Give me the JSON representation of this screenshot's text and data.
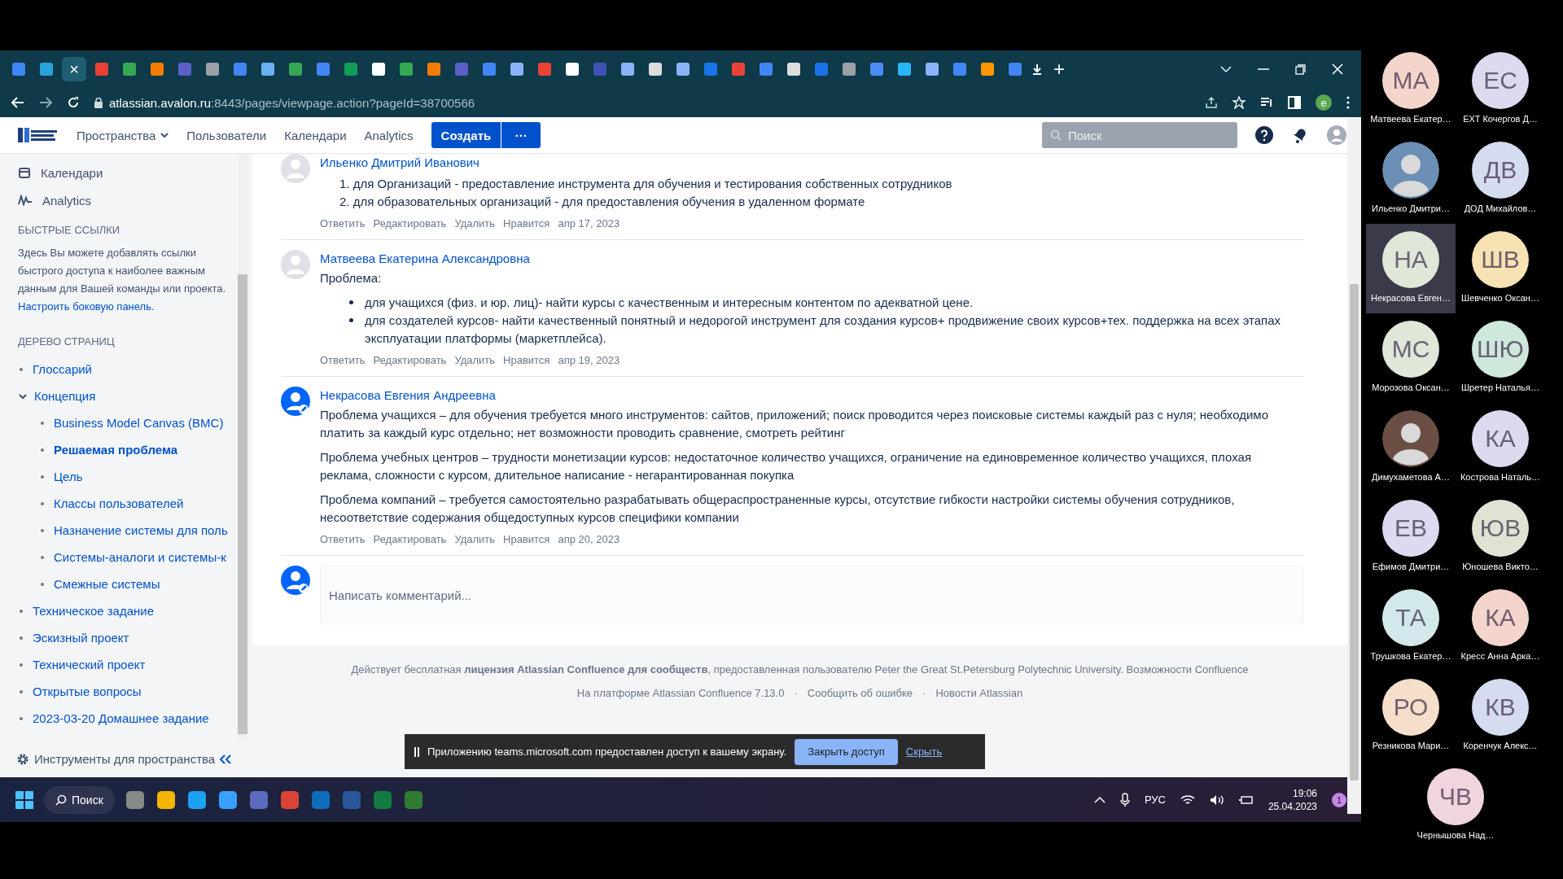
{
  "browser": {
    "tabs": [
      {
        "selected": false
      },
      {
        "selected": false
      },
      {
        "selected": true
      },
      {
        "selected": false
      },
      {
        "selected": false
      },
      {
        "selected": false
      },
      {
        "selected": false
      },
      {
        "selected": false
      },
      {
        "selected": false
      },
      {
        "selected": false
      },
      {
        "selected": false
      },
      {
        "selected": false
      },
      {
        "selected": false
      },
      {
        "selected": false
      },
      {
        "selected": false
      },
      {
        "selected": false
      },
      {
        "selected": false
      },
      {
        "selected": false
      },
      {
        "selected": false
      },
      {
        "selected": false
      },
      {
        "selected": false
      },
      {
        "selected": false
      },
      {
        "selected": false
      },
      {
        "selected": false
      },
      {
        "selected": false
      },
      {
        "selected": false
      },
      {
        "selected": false
      },
      {
        "selected": false
      },
      {
        "selected": false
      },
      {
        "selected": false
      },
      {
        "selected": false
      },
      {
        "selected": false
      },
      {
        "selected": false
      },
      {
        "selected": false
      },
      {
        "selected": false
      },
      {
        "selected": false
      },
      {
        "selected": false
      }
    ],
    "tab_close": "×",
    "new_tab": "+",
    "profile_letter": "e",
    "url_host": "atlassian.avalon.ru",
    "url_rest": ":8443/pages/viewpage.action?pageId=38700566"
  },
  "header": {
    "nav": [
      {
        "label": "Пространства",
        "kind": "menu"
      },
      {
        "label": "Пользователи",
        "kind": "link"
      },
      {
        "label": "Календари",
        "kind": "link"
      },
      {
        "label": "Analytics",
        "kind": "link"
      }
    ],
    "create": "Создать",
    "more": "···",
    "search": {
      "placeholder": "Поиск"
    }
  },
  "sidebar": {
    "links": [
      {
        "label": "Календари",
        "kind": "calendar"
      },
      {
        "label": "Analytics",
        "kind": "analytics"
      }
    ],
    "quick_links_title": "БЫСТРЫЕ ССЫЛКИ",
    "quick_links_text": "Здесь Вы можете добавлять ссылки быстрого доступа к наиболее важным данным для Вашей команды или проекта.",
    "quick_links_link": "Настроить боковую панель.",
    "tree_title": "ДЕРЕВО СТРАНИЦ",
    "tree": [
      {
        "label": "Глоссарий",
        "selected": false
      },
      {
        "label": "Концепция",
        "selected": false,
        "expanded": true,
        "children": [
          {
            "label": "Business Model Canvas (BMC)",
            "selected": false
          },
          {
            "label": "Решаемая проблема",
            "selected": true
          },
          {
            "label": "Цель",
            "selected": false
          },
          {
            "label": "Классы пользователей",
            "selected": false
          },
          {
            "label": "Назначение системы для поль",
            "selected": false
          },
          {
            "label": "Системы-аналоги и системы-к",
            "selected": false
          },
          {
            "label": "Смежные системы",
            "selected": false
          }
        ]
      },
      {
        "label": "Техническое задание",
        "selected": false
      },
      {
        "label": "Эскизный проект",
        "selected": false
      },
      {
        "label": "Технический проект",
        "selected": false
      },
      {
        "label": "Открытые вопросы",
        "selected": false
      },
      {
        "label": "2023-03-20 Домашнее задание",
        "selected": false
      }
    ],
    "tools": "Инструменты для пространства"
  },
  "comments": [
    {
      "author": "Ильенко Дмитрий Иванович",
      "custom_avatar": false,
      "blocks": [
        {
          "kind": "ordered_list",
          "items": [
            {
              "number": "1.",
              "text": "для Организаций - предоставление инструмента для обучения и тестирования собственных сотрудников"
            },
            {
              "number": "2.",
              "text": "для образовательных организаций - для предоставления обучения в удаленном формате"
            }
          ]
        }
      ],
      "actions": [
        "Ответить",
        "Редактировать",
        "Удалить",
        "Нравится"
      ],
      "date": "апр 17, 2023"
    },
    {
      "author": "Матвеева Екатерина Александровна",
      "custom_avatar": false,
      "blocks": [
        {
          "kind": "paragraph",
          "text": "Проблема:"
        },
        {
          "kind": "bullet_list",
          "items": [
            "для учащихся (физ. и юр. лиц)- найти курсы с качественным и интересным контентом по адекватной цене.",
            "для создателей курсов- найти качественный понятный и недорогой инструмент для создания курсов+ продвижение своих курсов+тех. поддержка на всех этапах эксплуатации платформы (маркетплейса)."
          ]
        }
      ],
      "actions": [
        "Ответить",
        "Редактировать",
        "Удалить",
        "Нравится"
      ],
      "date": "апр 19, 2023"
    },
    {
      "author": "Некрасова Евгения Андреевна",
      "custom_avatar": true,
      "blocks": [
        {
          "kind": "paragraph",
          "text": "Проблема учащихся – для обучения требуется много инструментов: сайтов, приложений; поиск проводится через поисковые системы каждый раз с нуля; необходимо платить за каждый курс отдельно; нет возможности проводить сравнение, смотреть рейтинг"
        },
        {
          "kind": "paragraph",
          "text": "Проблема учебных центров – трудности монетизации курсов: недостаточное количество учащихся, ограничение на единовременное количество учащихся, плохая реклама, сложности с курсом, длительное написание - негарантированная покупка"
        },
        {
          "kind": "paragraph",
          "text": "Проблема компаний – требуется самостоятельно разрабатывать общераспространенные курсы, отсутствие гибкости настройки системы обучения сотрудников, несоответствие содержания общедоступных курсов специфики компании"
        }
      ],
      "actions": [
        "Ответить",
        "Редактировать",
        "Удалить",
        "Нравится"
      ],
      "date": "апр 20, 2023"
    }
  ],
  "comment_input": {
    "placeholder": "Написать комментарий..."
  },
  "footer": {
    "license": "Действует бесплатная **лицензия Atlassian Confluence для сообществ**, предоставленная пользователю Peter the Great St.Petersburg Polytechnic University.",
    "license_link": "Возможности Confluence",
    "links": [
      "На платформе Atlassian Confluence 7.13.0",
      "Сообщить об ошибке",
      "Новости Atlassian"
    ],
    "separator": "·"
  },
  "share_bar": {
    "text": "Приложению teams.microsoft.com предоставлен доступ к вашему экрану.",
    "stop": "Закрыть доступ",
    "hide": "Скрыть"
  },
  "taskbar": {
    "search": "Поиск",
    "language": "РУС",
    "time": "19:06",
    "date": "25.04.2023",
    "notifications": "1"
  },
  "participants": [
    {
      "initials": "МА",
      "name": "Матвеева Екатер…",
      "kind": "initials",
      "color": "#f3d5cb",
      "active": false
    },
    {
      "initials": "ЕС",
      "name": "EXT Кочергов Д…",
      "kind": "initials",
      "color": "#dcdaef",
      "active": false
    },
    {
      "name": "Ильенко Дмитри…",
      "kind": "photo",
      "color": "#6b8fb5",
      "active": false
    },
    {
      "initials": "ДВ",
      "name": "ДОД Михайлов…",
      "kind": "initials",
      "color": "#d5dcef",
      "active": false
    },
    {
      "initials": "НА",
      "name": "Некрасова Евген…",
      "kind": "initials",
      "color": "#dfe7d8",
      "active": true
    },
    {
      "initials": "ШВ",
      "name": "Шевченко Оксан…",
      "kind": "initials",
      "color": "#f6e2b3",
      "active": false
    },
    {
      "initials": "МС",
      "name": "Морозова Оксан…",
      "kind": "initials",
      "color": "#dfe7d8",
      "active": false
    },
    {
      "initials": "ШЮ",
      "name": "Шретер Наталья…",
      "kind": "initials",
      "color": "#cfe8dc",
      "active": false
    },
    {
      "name": "Димухаметова А…",
      "kind": "photo",
      "color": "#6b4f45",
      "active": false
    },
    {
      "initials": "КА",
      "name": "Кострова Наталь…",
      "kind": "initials",
      "color": "#dcdaef",
      "active": false
    },
    {
      "initials": "ЕВ",
      "name": "Ефимов Дмитри…",
      "kind": "initials",
      "color": "#dcdaef",
      "active": false
    },
    {
      "initials": "ЮВ",
      "name": "Юношева Викто…",
      "kind": "initials",
      "color": "#dfe3d4",
      "active": false
    },
    {
      "initials": "ТА",
      "name": "Трушкова Екатер…",
      "kind": "initials",
      "color": "#d3e8ea",
      "active": false
    },
    {
      "initials": "КА",
      "name": "Кресс Анна Арка…",
      "kind": "initials",
      "color": "#f3d5cb",
      "active": false
    },
    {
      "initials": "РО",
      "name": "Резникова Мари…",
      "kind": "initials",
      "color": "#f6dfca",
      "active": false
    },
    {
      "initials": "КВ",
      "name": "Коренчук Алекс…",
      "kind": "initials",
      "color": "#d5dcef",
      "active": false
    },
    {
      "initials": "ЧВ",
      "name": "Чернышова Над…",
      "kind": "initials",
      "color": "#f0d5dd",
      "active": false
    }
  ]
}
